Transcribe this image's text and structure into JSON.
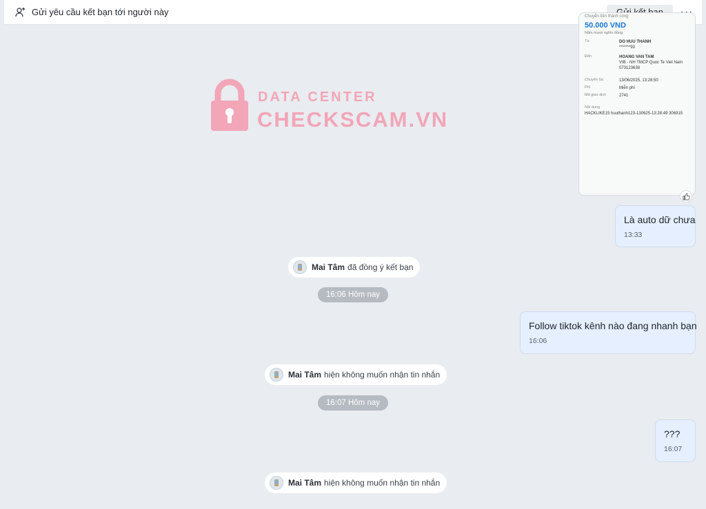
{
  "topbar": {
    "add_friend_label": "Gửi yêu cầu kết bạn tới người này",
    "send_button": "Gửi kết bạn",
    "more_label": "···"
  },
  "watermark": {
    "line1": "DATA CENTER",
    "line2": "CHECKSCAM.VN"
  },
  "receipt": {
    "status": "Chuyển tiền thành công",
    "amount": "50.000 VND",
    "amount_words": "Năm mươi nghìn đồng",
    "rows": [
      {
        "key": "Từ",
        "line1": "DO HUU THANH",
        "line2": "*******93"
      },
      {
        "key": "Đến",
        "line1": "HOANG VAN TAM",
        "line2": "VIB - NH TMCP Quoc Te Viet Nam",
        "line3": "073123638"
      },
      {
        "key": "Chuyển lúc",
        "line1": "13/06/2025, 13:28:50"
      },
      {
        "key": "Phí",
        "line1": "Miễn phí"
      },
      {
        "key": "Mã giao dịch",
        "line1": "2741"
      }
    ],
    "note_label": "Nội dung",
    "note": "HACKLIKE15 huuthanh123-130625-13:28:49 306915"
  },
  "messages": [
    {
      "text": "Là auto dữ chưa",
      "time": "13:33"
    },
    {
      "text": "Follow tiktok kênh nào đang nhanh bạn",
      "time": "16:06"
    },
    {
      "text": "???",
      "time": "16:07"
    }
  ],
  "notices": [
    {
      "name": "Mai Tâm",
      "text": "đã đồng ý kết bạn"
    },
    {
      "name": "Mai Tâm",
      "text": "hiện không muốn nhận tin nhắn"
    },
    {
      "name": "Mai Tâm",
      "text": "hiện không muốn nhận tin nhắn"
    }
  ],
  "time_separators": [
    "16:06 Hôm nay",
    "16:07 Hôm nay"
  ],
  "colors": {
    "background": "#e9ecf0",
    "outgoing_bubble": "#e5efff",
    "time_pill": "#b6bbc2",
    "watermark": "#f2a6b8",
    "amount": "#1976d2"
  }
}
